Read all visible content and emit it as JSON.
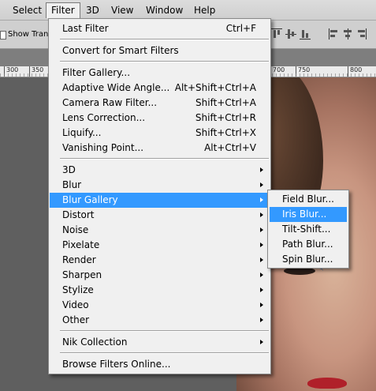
{
  "menubar": {
    "items": [
      "Select",
      "Filter",
      "3D",
      "View",
      "Window",
      "Help"
    ],
    "active": "Filter"
  },
  "options": {
    "show_transform_label": "Show Tran"
  },
  "ruler": {
    "ticks": [
      "300",
      "350",
      "700",
      "750",
      "800"
    ]
  },
  "filter_menu": {
    "last_filter": {
      "label": "Last Filter",
      "shortcut": "Ctrl+F"
    },
    "convert_smart": {
      "label": "Convert for Smart Filters"
    },
    "gallery_group": [
      {
        "label": "Filter Gallery...",
        "shortcut": ""
      },
      {
        "label": "Adaptive Wide Angle...",
        "shortcut": "Alt+Shift+Ctrl+A"
      },
      {
        "label": "Camera Raw Filter...",
        "shortcut": "Shift+Ctrl+A"
      },
      {
        "label": "Lens Correction...",
        "shortcut": "Shift+Ctrl+R"
      },
      {
        "label": "Liquify...",
        "shortcut": "Shift+Ctrl+X"
      },
      {
        "label": "Vanishing Point...",
        "shortcut": "Alt+Ctrl+V"
      }
    ],
    "category_group": [
      {
        "label": "3D"
      },
      {
        "label": "Blur"
      },
      {
        "label": "Blur Gallery"
      },
      {
        "label": "Distort"
      },
      {
        "label": "Noise"
      },
      {
        "label": "Pixelate"
      },
      {
        "label": "Render"
      },
      {
        "label": "Sharpen"
      },
      {
        "label": "Stylize"
      },
      {
        "label": "Video"
      },
      {
        "label": "Other"
      }
    ],
    "nik_collection": {
      "label": "Nik Collection"
    },
    "browse_online": {
      "label": "Browse Filters Online..."
    }
  },
  "blur_gallery_submenu": {
    "items": [
      "Field Blur...",
      "Iris Blur...",
      "Tilt-Shift...",
      "Path Blur...",
      "Spin Blur..."
    ],
    "highlighted": "Iris Blur..."
  },
  "colors": {
    "highlight": "#3399ff",
    "menu_bg": "#f0f0f0"
  }
}
